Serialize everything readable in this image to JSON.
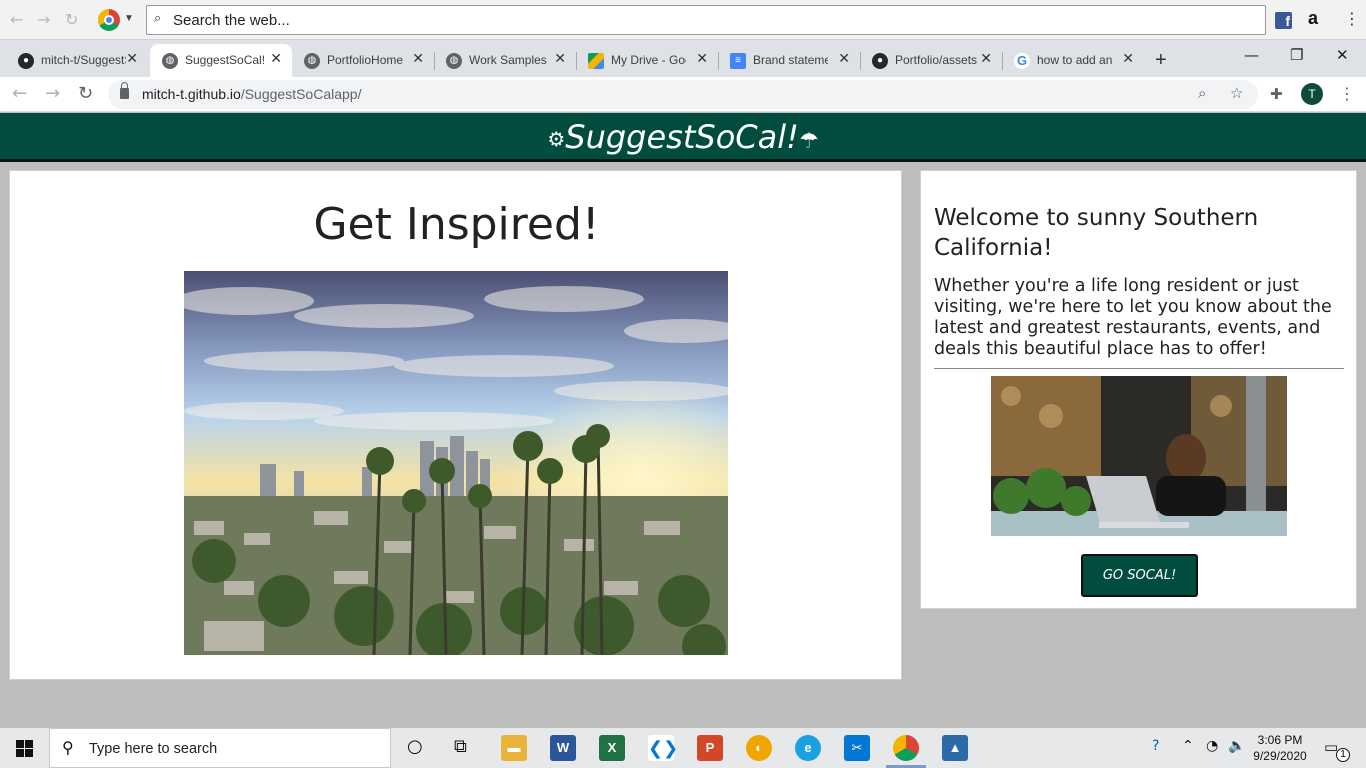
{
  "topbar": {
    "search_placeholder": "Search the web...",
    "amazon_letter": "a",
    "facebook_letter": "f"
  },
  "tabs": [
    {
      "label": "mitch-t/SuggestSoCal",
      "favicon": "github-icon"
    },
    {
      "label": "SuggestSoCal!",
      "favicon": "globe-icon",
      "active": true
    },
    {
      "label": "PortfolioHome",
      "favicon": "globe-icon"
    },
    {
      "label": "Work Samples",
      "favicon": "globe-icon"
    },
    {
      "label": "My Drive - Google Drive",
      "favicon": "drive-icon"
    },
    {
      "label": "Brand statement",
      "favicon": "docs-icon"
    },
    {
      "label": "Portfolio/assets",
      "favicon": "github-icon"
    },
    {
      "label": "how to add an",
      "favicon": "google-icon"
    }
  ],
  "address": {
    "host": "mitch-t.github.io",
    "path": "/SuggestSoCalapp/"
  },
  "profile_initial": "T",
  "site": {
    "title": "SuggestSoCal!",
    "brand_color": "#004c3f",
    "main_heading": "Get Inspired!",
    "side_heading": "Welcome to sunny Southern California!",
    "side_text": "Whether you're a life long resident or just visiting, we're here to let you know about the latest and greatest restaurants, events, and deals this beautiful place has to offer!",
    "cta_label": "GO SOCAL!"
  },
  "taskbar": {
    "search_placeholder": "Type here to search",
    "time": "3:06 PM",
    "date": "9/29/2020",
    "notification_count": "1"
  }
}
